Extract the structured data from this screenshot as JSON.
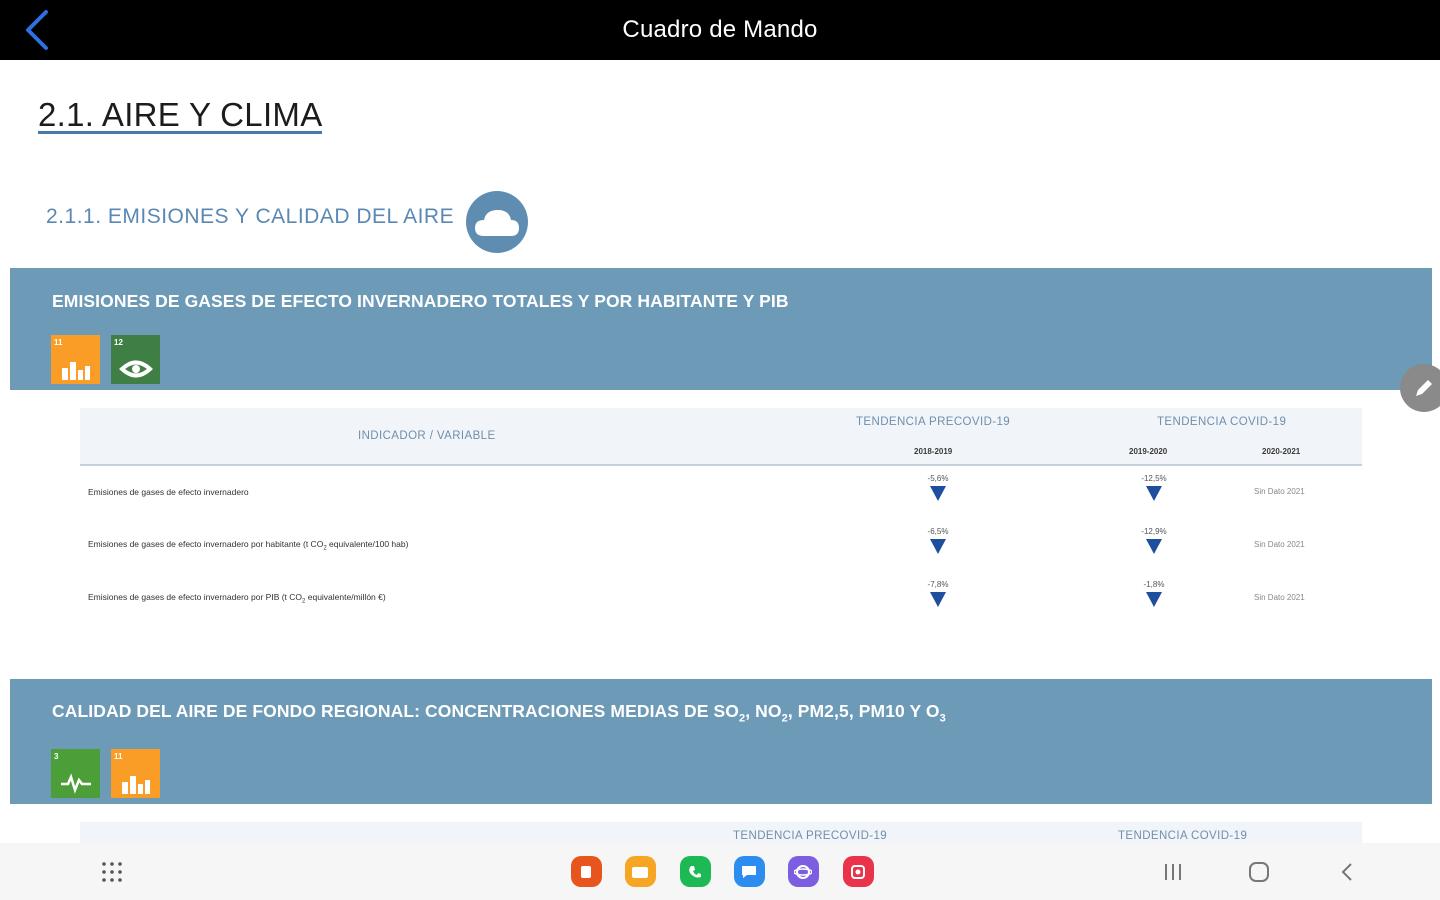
{
  "header": {
    "title": "Cuadro de Mando"
  },
  "page": {
    "title": "2.1. AIRE Y CLIMA",
    "section_title": "2.1.1. EMISIONES Y CALIDAD DEL AIRE"
  },
  "indicator1": {
    "title": "EMISIONES DE GASES DE EFECTO INVERNADERO TOTALES Y POR HABITANTE Y PIB",
    "sdg_badges": [
      {
        "icon": "sdg-11-sustainable-cities-icon",
        "color": "#f99d26"
      },
      {
        "icon": "sdg-12-responsible-consumption-icon",
        "color": "#3f7e44"
      }
    ],
    "table": {
      "col_indicator": "INDICADOR / VARIABLE",
      "col_precovid": "TENDENCIA PRECOVID-19",
      "col_covid": "TENDENCIA COVID-19",
      "period_1": "2018-2019",
      "period_2": "2019-2020",
      "period_3": "2020-2021",
      "rows": [
        {
          "label": "Emisiones de gases de efecto invernadero",
          "v1": "-5,6%",
          "v2": "-12,5%",
          "v3": "Sin Dato 2021"
        },
        {
          "label_main": "Emisiones de gases de efecto invernadero por habitante (t CO",
          "label_sub": "2",
          "label_tail": " equivalente/100 hab)",
          "v1": "-6,5%",
          "v2": "-12,9%",
          "v3": "Sin Dato 2021"
        },
        {
          "label_main": "Emisiones de gases de efecto invernadero por PIB (t CO",
          "label_sub": "2",
          "label_tail": " equivalente/millón €)",
          "v1": "-7,8%",
          "v2": "-1,8%",
          "v3": "Sin Dato 2021"
        }
      ]
    }
  },
  "indicator2": {
    "title_part1": "CALIDAD DEL AIRE DE FONDO REGIONAL: CONCENTRACIONES MEDIAS DE SO",
    "title_sub1": "2",
    "title_part2": ", NO",
    "title_sub2": "2",
    "title_part3": ", PM2,5, PM10 Y O",
    "title_sub3": "3",
    "sdg_badges": [
      {
        "icon": "sdg-3-good-health-icon",
        "color": "#4c9f38"
      },
      {
        "icon": "sdg-11-sustainable-cities-icon",
        "color": "#f99d26"
      }
    ],
    "table": {
      "col_precovid": "TENDENCIA PRECOVID-19",
      "col_covid": "TENDENCIA COVID-19"
    }
  },
  "colors": {
    "band": "#6d9ab7",
    "accent": "#5b88b3",
    "trend_down": "#1e4f9c",
    "topbar": "#000000"
  },
  "trend_icon": "down-triangle-icon",
  "navbar": {
    "apps": [
      {
        "name": "app-icon-1",
        "color": "#e8541d"
      },
      {
        "name": "app-icon-2",
        "color": "#f6a623"
      },
      {
        "name": "app-icon-3",
        "color": "#1db954"
      },
      {
        "name": "app-icon-4",
        "color": "#2d8cf0"
      },
      {
        "name": "app-icon-5",
        "color": "#7b5fe0"
      },
      {
        "name": "app-icon-6",
        "color": "#e8334a"
      }
    ]
  }
}
